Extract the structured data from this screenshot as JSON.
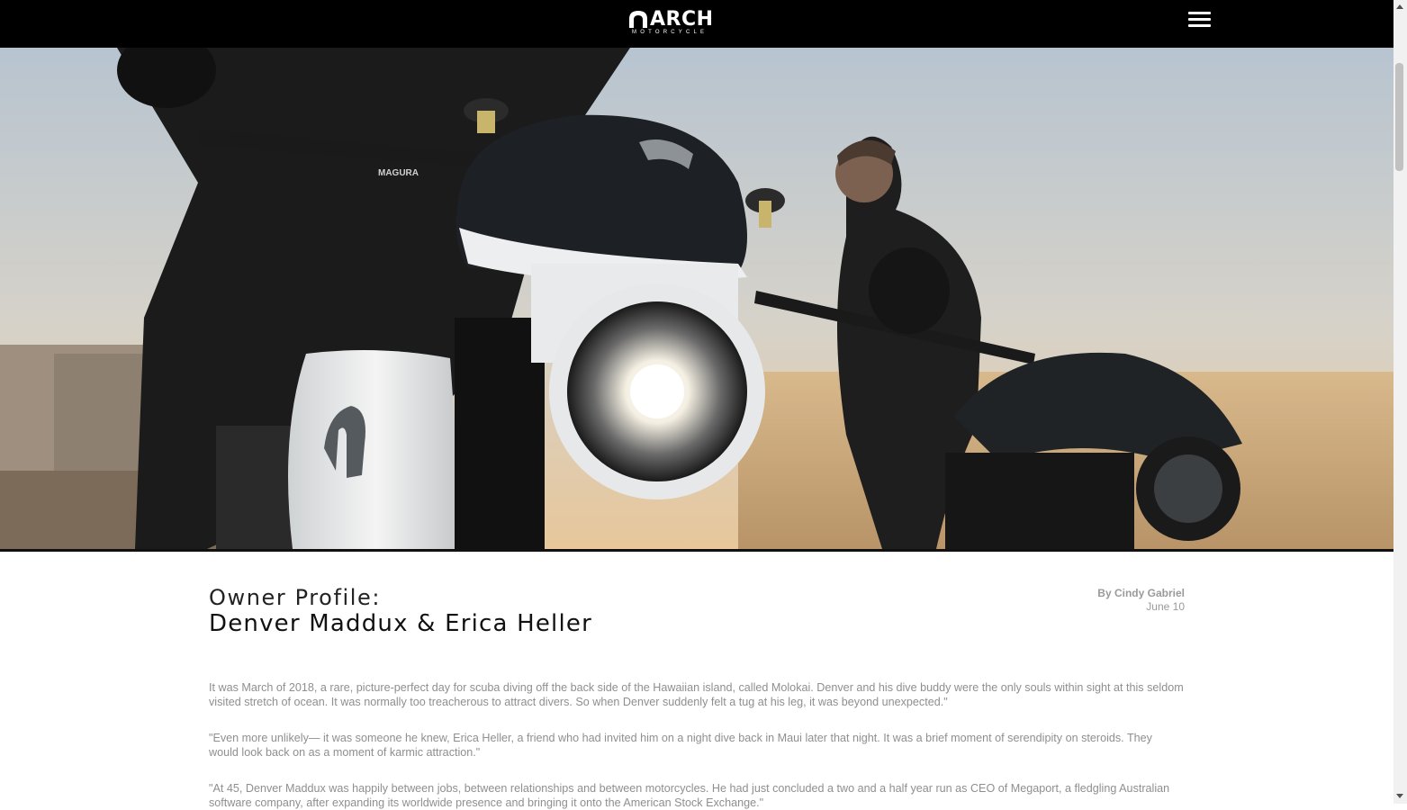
{
  "header": {
    "logo_text": "ARCH",
    "logo_subtext": "MOTORCYCLE",
    "menu_icon": "hamburger-menu-icon"
  },
  "hero": {
    "image": "photo of two riders with Arch motorcycles at sunset, white bike with glowing headlight in foreground",
    "tank_text": "MAGURA"
  },
  "article": {
    "title_prefix": "Owner Profile:",
    "title": "Denver Maddux & Erica Heller",
    "author": "By Cindy Gabriel",
    "date": "June 10",
    "paragraphs": [
      "It was March of 2018, a rare, picture-perfect day for scuba diving off the back side of the Hawaiian island, called Molokai. Denver and his dive buddy were the only souls within sight at this seldom visited stretch of ocean. It was normally too treacherous to attract divers. So when Denver suddenly felt a tug at his leg, it was beyond unexpected.\"",
      "\"Even more unlikely— it was someone he knew, Erica Heller, a friend who had invited him on a night dive back in Maui later that night. It was a brief moment of serendipity on steroids. They would look back on as a moment of karmic attraction.\"",
      "\"At 45, Denver Maddux was happily between jobs, between relationships and between motorcycles. He had just concluded a two and a half year run as CEO of Megaport, a fledgling Australian software company, after expanding its worldwide presence and bringing it onto the American Stock Exchange.\""
    ]
  },
  "colors": {
    "header_bg": "#000000",
    "body_text": "#8f8f8f",
    "title_text": "#111111"
  }
}
